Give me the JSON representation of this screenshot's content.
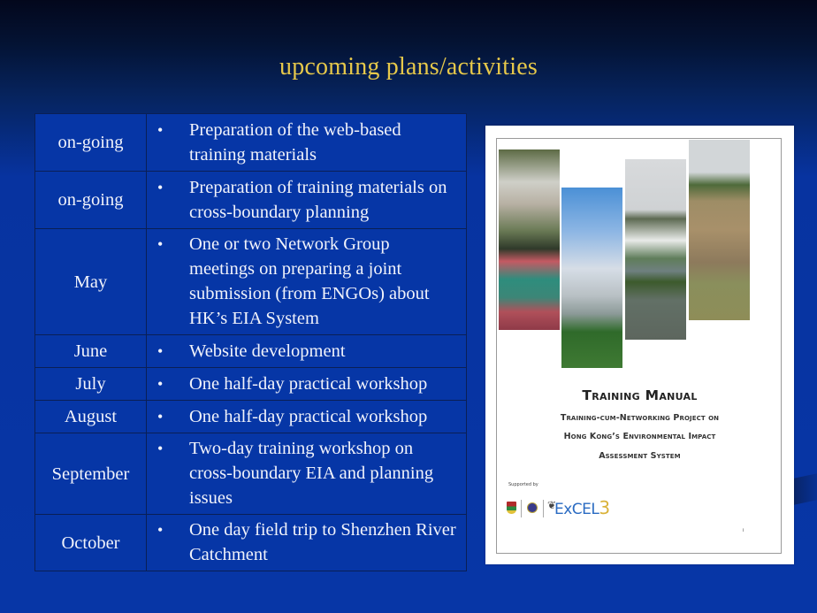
{
  "slide": {
    "title": "upcoming plans/activities",
    "colors": {
      "title": "#e6c84a",
      "background": "#0736a6",
      "table_cell": "#0636a6",
      "text": "#f1f3fb"
    }
  },
  "schedule": {
    "bullet": "•",
    "rows": [
      {
        "when": "on-going",
        "activity": "Preparation of the web-based training materials"
      },
      {
        "when": "on-going",
        "activity": "Preparation of training materials on cross-boundary planning"
      },
      {
        "when": "May",
        "activity": "One or two Network Group meetings on preparing a joint submission (from ENGOs) about HK’s EIA System"
      },
      {
        "when": "June",
        "activity": "Website development"
      },
      {
        "when": "July",
        "activity": "One half-day practical workshop"
      },
      {
        "when": "August",
        "activity": "One half-day practical workshop"
      },
      {
        "when": "September",
        "activity": "Two-day training workshop on cross-boundary EIA and planning issues"
      },
      {
        "when": "October",
        "activity": "One day field trip to Shenzhen River Catchment"
      }
    ]
  },
  "manual_cover": {
    "title": "Training Manual",
    "subtitle_lines": [
      "Training-cum-Networking Project on",
      "Hong Kong’s Environmental Impact",
      "Assessment System"
    ],
    "supported_by": "Supported by",
    "logos": [
      "university-crest",
      "round-seal",
      "ExCEL3"
    ],
    "excel_text": "ExCEL",
    "excel_number": "3",
    "page_number": "i"
  }
}
